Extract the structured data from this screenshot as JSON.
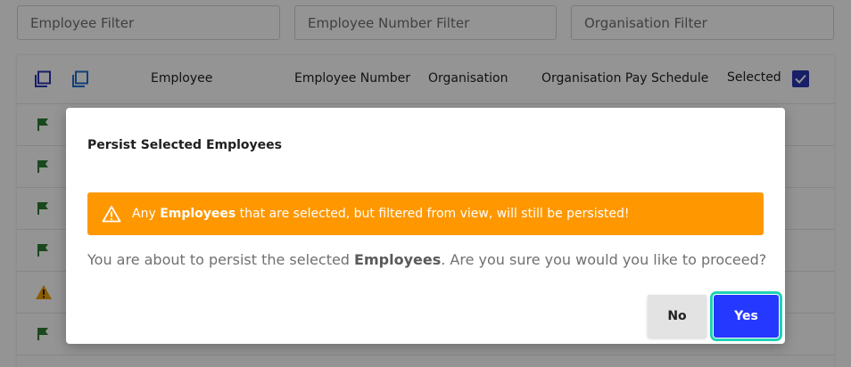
{
  "filters": {
    "employee_placeholder": "Employee Filter",
    "employee_number_placeholder": "Employee Number Filter",
    "organisation_placeholder": "Organisation Filter"
  },
  "table": {
    "headers": {
      "employee": "Employee",
      "employee_number": "Employee Number",
      "organisation": "Organisation",
      "pay_schedule": "Organisation Pay Schedule",
      "selected": "Selected"
    },
    "select_all_checked": true,
    "rows": [
      {
        "status_icon": "flag-icon"
      },
      {
        "status_icon": "flag-icon"
      },
      {
        "status_icon": "flag-icon"
      },
      {
        "status_icon": "flag-icon"
      },
      {
        "status_icon": "warning-icon"
      },
      {
        "status_icon": "flag-icon"
      }
    ]
  },
  "modal": {
    "title": "Persist Selected Employees",
    "alert": {
      "prefix": "Any ",
      "bold": "Employees",
      "suffix": " that are selected, but filtered from view, will still be persisted!"
    },
    "message": {
      "prefix": "You are about to persist the selected ",
      "bold": "Employees",
      "suffix": ". Are you sure you would you like to proceed?"
    },
    "no_label": "No",
    "yes_label": "Yes"
  },
  "colors": {
    "accent": "#2438ff",
    "warning": "#ff9800",
    "flag": "#2e7d32",
    "focus_ring": "#1fd3b5",
    "checkbox": "#2a36b3"
  }
}
